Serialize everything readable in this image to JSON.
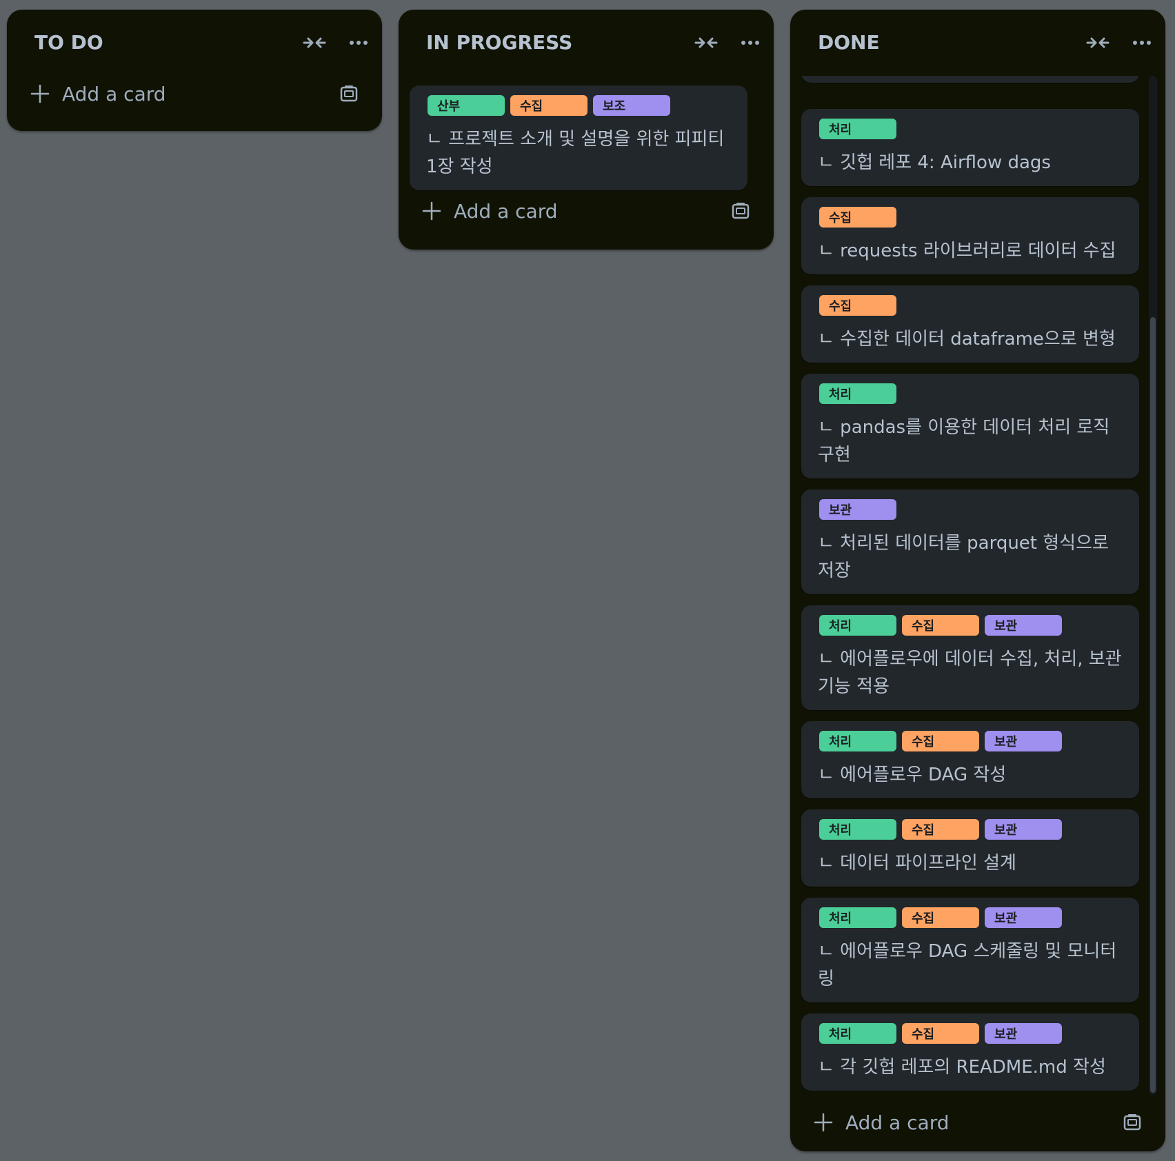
{
  "board": {
    "add_card_label": "Add a card",
    "lists": [
      {
        "title": "TO DO",
        "cards": []
      },
      {
        "title": "IN PROGRESS",
        "cards": [
          {
            "labels": [
              {
                "text": "산부",
                "color": "green"
              },
              {
                "text": "수집",
                "color": "orange"
              },
              {
                "text": "보조",
                "color": "purple"
              }
            ],
            "title": "ㄴ 프로젝트 소개 및 설명을 위한 피피티 1장 작성"
          }
        ]
      },
      {
        "title": "DONE",
        "cards": [
          {
            "labels": [
              {
                "text": "처리",
                "color": "green"
              }
            ],
            "title": "ㄴ 깃헙 레포 4: Airflow dags"
          },
          {
            "labels": [
              {
                "text": "수집",
                "color": "orange"
              }
            ],
            "title": "ㄴ requests 라이브러리로 데이터 수집"
          },
          {
            "labels": [
              {
                "text": "수집",
                "color": "orange"
              }
            ],
            "title": "ㄴ 수집한 데이터 dataframe으로 변형"
          },
          {
            "labels": [
              {
                "text": "처리",
                "color": "green"
              }
            ],
            "title": "ㄴ pandas를 이용한 데이터 처리 로직 구현"
          },
          {
            "labels": [
              {
                "text": "보관",
                "color": "purple"
              }
            ],
            "title": "ㄴ 처리된 데이터를 parquet 형식으로 저장"
          },
          {
            "labels": [
              {
                "text": "처리",
                "color": "green"
              },
              {
                "text": "수집",
                "color": "orange"
              },
              {
                "text": "보관",
                "color": "purple"
              }
            ],
            "title": "ㄴ 에어플로우에 데이터 수집, 처리, 보관 기능 적용"
          },
          {
            "labels": [
              {
                "text": "처리",
                "color": "green"
              },
              {
                "text": "수집",
                "color": "orange"
              },
              {
                "text": "보관",
                "color": "purple"
              }
            ],
            "title": "ㄴ 에어플로우 DAG 작성"
          },
          {
            "labels": [
              {
                "text": "처리",
                "color": "green"
              },
              {
                "text": "수집",
                "color": "orange"
              },
              {
                "text": "보관",
                "color": "purple"
              }
            ],
            "title": "ㄴ 데이터 파이프라인 설계"
          },
          {
            "labels": [
              {
                "text": "처리",
                "color": "green"
              },
              {
                "text": "수집",
                "color": "orange"
              },
              {
                "text": "보관",
                "color": "purple"
              }
            ],
            "title": "ㄴ 에어플로우 DAG 스케줄링 및 모니터링"
          },
          {
            "labels": [
              {
                "text": "처리",
                "color": "green"
              },
              {
                "text": "수집",
                "color": "orange"
              },
              {
                "text": "보관",
                "color": "purple"
              }
            ],
            "title": "ㄴ 각 깃헙 레포의 README.md 작성"
          }
        ]
      }
    ]
  },
  "colors": {
    "green": "#4bce97",
    "orange": "#fea362",
    "purple": "#9f8fef",
    "list_bg": "#101204",
    "card_bg": "#22272b"
  },
  "icons": {
    "collapse": "collapse-icon",
    "more": "more-icon",
    "add": "plus-icon",
    "template": "template-icon"
  }
}
